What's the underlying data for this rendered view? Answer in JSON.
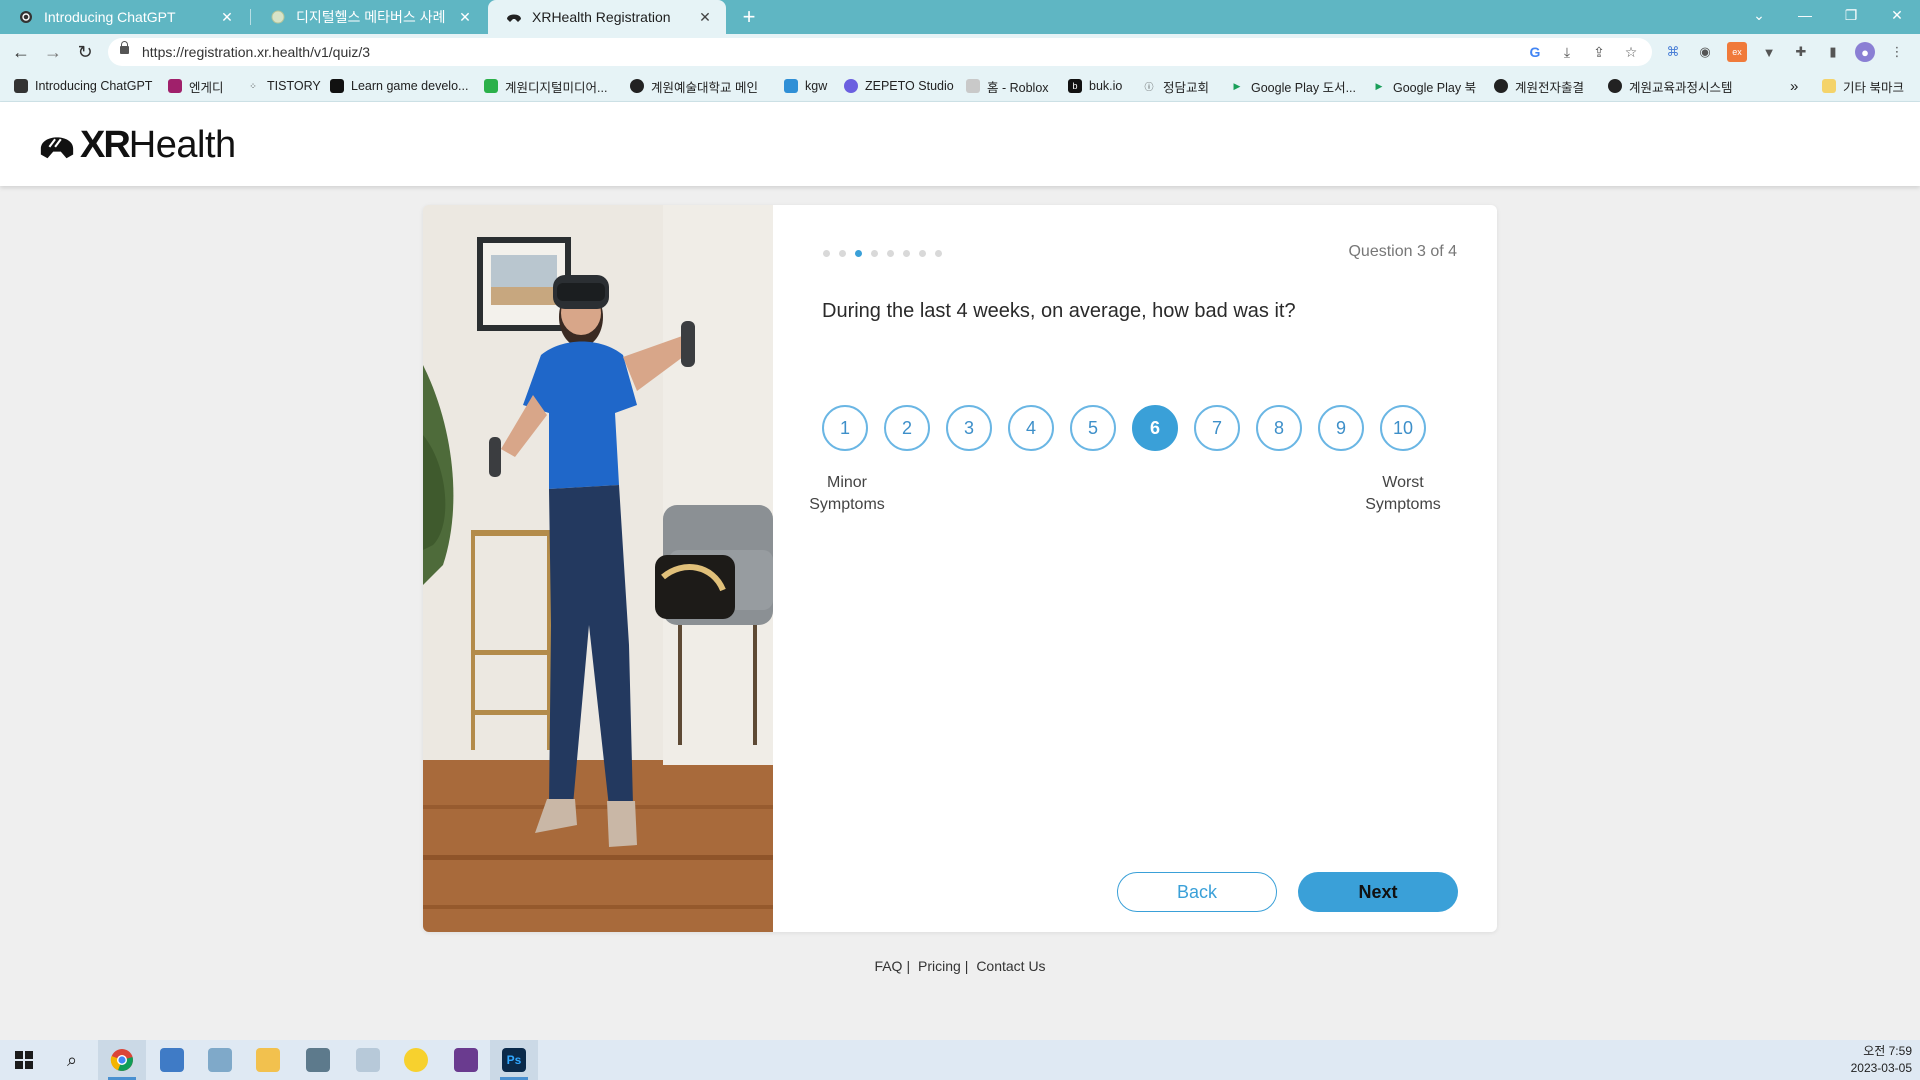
{
  "browser": {
    "tabs": [
      {
        "title": "Introducing ChatGPT",
        "icon": "openai-icon"
      },
      {
        "title": "디지털헬스 메타버스 사례",
        "icon": "globe-icon"
      },
      {
        "title": "XRHealth Registration",
        "icon": "xrhealth-icon"
      }
    ],
    "url": "https://registration.xr.health/v1/quiz/3",
    "bookmarks": [
      "Introducing ChatGPT",
      "엔게디",
      "TISTORY",
      "Learn game develo...",
      "계원디지털미디어...",
      "계원예술대학교 메인",
      "kgw",
      "ZEPETO Studio",
      "홈 - Roblox",
      "buk.io",
      "정담교회",
      "Google Play 도서...",
      "Google Play 북",
      "계원전자출결",
      "계원교육과정시스템"
    ],
    "bookmarks_overflow": "»",
    "other_bookmarks": "기타 북마크"
  },
  "site": {
    "logo_bold": "XR",
    "logo_light": "Health"
  },
  "quiz": {
    "progress_total": 8,
    "progress_current": 3,
    "question_count": "Question 3 of 4",
    "question": "During the last 4 weeks, on average, how bad was it?",
    "options": [
      "1",
      "2",
      "3",
      "4",
      "5",
      "6",
      "7",
      "8",
      "9",
      "10"
    ],
    "selected": "6",
    "label_min_1": "Minor",
    "label_min_2": "Symptoms",
    "label_max_1": "Worst",
    "label_max_2": "Symptoms",
    "back_label": "Back",
    "next_label": "Next",
    "accent": "#3aa0d8"
  },
  "footer": {
    "faq": "FAQ",
    "pricing": "Pricing",
    "contact": "Contact Us",
    "sep": "|"
  },
  "taskbar": {
    "time": "오전 7:59",
    "date": "2023-03-05"
  }
}
